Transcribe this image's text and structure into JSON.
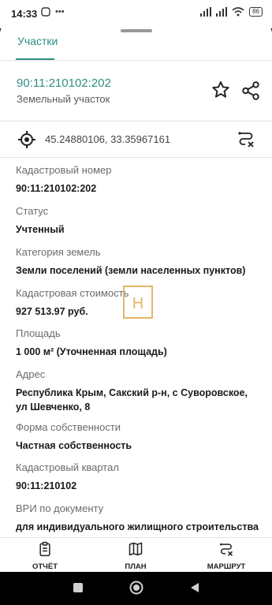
{
  "status_bar": {
    "time": "14:33",
    "battery": "86"
  },
  "tabs": [
    {
      "label": "Участки"
    }
  ],
  "parcel": {
    "cadastral_title": "90:11:210102:202",
    "subtitle": "Земельный участок",
    "coordinates": "45.24880106, 33.35967161"
  },
  "fields": [
    {
      "label": "Кадастровый номер",
      "value": "90:11:210102:202"
    },
    {
      "label": "Статус",
      "value": "Учтенный"
    },
    {
      "label": "Категория земель",
      "value": "Земли поселений (земли населенных пунктов)"
    },
    {
      "label": "Кадастровая стоимость",
      "value": "927 513.97 руб."
    },
    {
      "label": "Площадь",
      "value": "1 000 м² (Уточненная площадь)"
    },
    {
      "label": "Адрес",
      "value": "Республика Крым, Сакский р-н, с Суворовское, ул Шевченко, 8"
    },
    {
      "label": "Форма собственности",
      "value": "Частная собственность"
    },
    {
      "label": "Кадастровый квартал",
      "value": "90:11:210102"
    },
    {
      "label": "ВРИ по документу",
      "value": "для индивидуального жилищного строительства"
    }
  ],
  "watermark": "H",
  "bottom_nav": [
    {
      "label": "ОТЧЁТ",
      "icon": "clipboard-icon"
    },
    {
      "label": "ПЛАН",
      "icon": "map-icon"
    },
    {
      "label": "МАРШРУТ",
      "icon": "route-icon"
    }
  ],
  "colors": {
    "accent": "#2f8f85",
    "watermark": "#e3b766"
  }
}
